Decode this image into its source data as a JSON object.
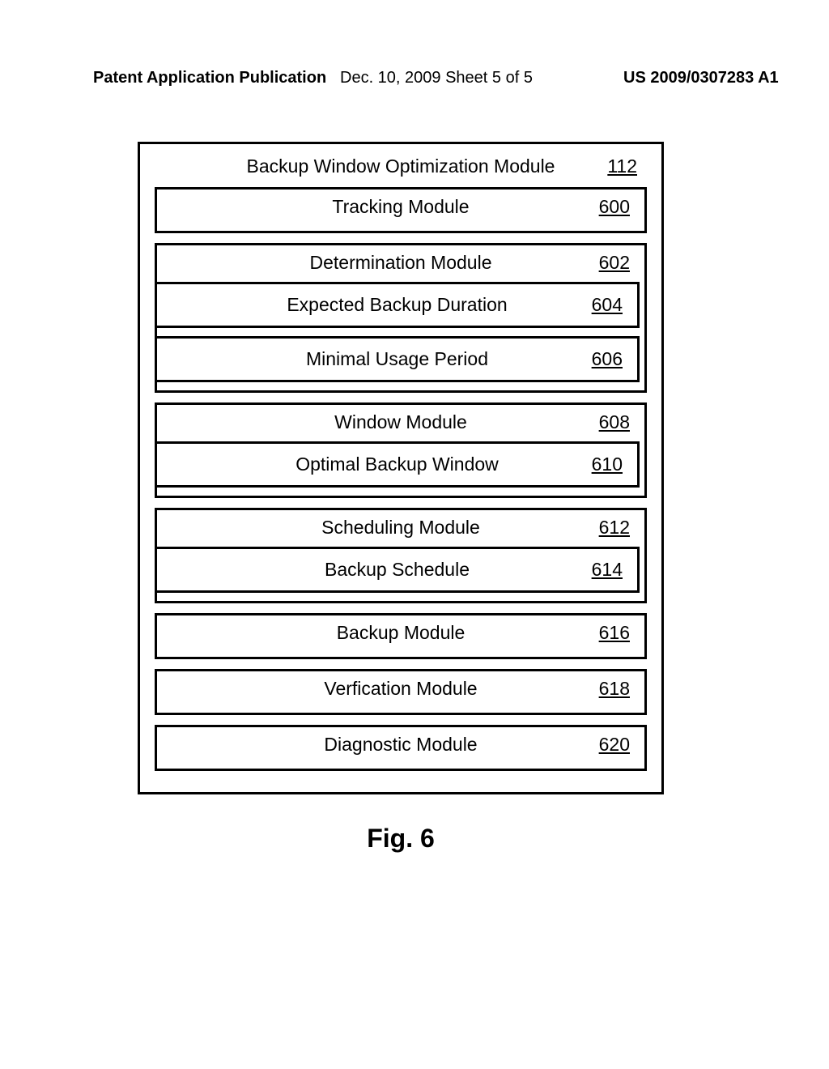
{
  "header": {
    "left": "Patent Application Publication",
    "mid": "Dec. 10, 2009  Sheet 5 of 5",
    "right": "US 2009/0307283 A1"
  },
  "outer": {
    "title": "Backup Window Optimization Module",
    "ref": "112"
  },
  "modules": [
    {
      "title": "Tracking Module",
      "ref": "600",
      "subs": []
    },
    {
      "title": "Determination Module",
      "ref": "602",
      "subs": [
        {
          "title": "Expected Backup Duration",
          "ref": "604"
        },
        {
          "title": "Minimal Usage Period",
          "ref": "606"
        }
      ]
    },
    {
      "title": "Window Module",
      "ref": "608",
      "subs": [
        {
          "title": "Optimal Backup Window",
          "ref": "610"
        }
      ]
    },
    {
      "title": "Scheduling Module",
      "ref": "612",
      "subs": [
        {
          "title": "Backup Schedule",
          "ref": "614"
        }
      ]
    },
    {
      "title": "Backup Module",
      "ref": "616",
      "subs": []
    },
    {
      "title": "Verfication Module",
      "ref": "618",
      "subs": []
    },
    {
      "title": "Diagnostic Module",
      "ref": "620",
      "subs": []
    }
  ],
  "caption": "Fig. 6"
}
